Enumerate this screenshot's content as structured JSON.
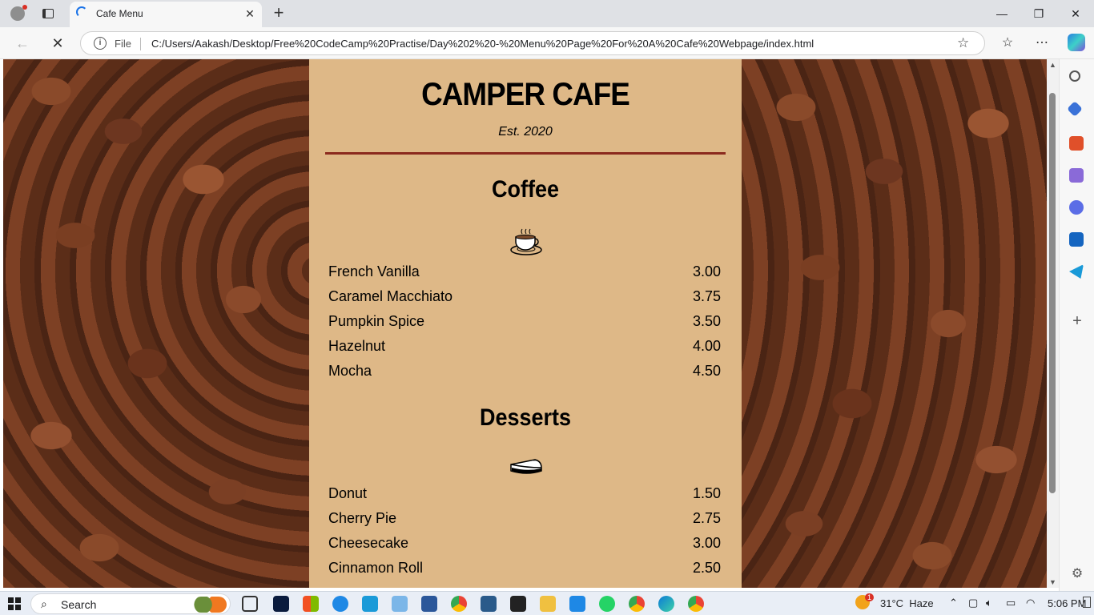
{
  "browser": {
    "tab_title": "Cafe Menu",
    "new_tab_symbol": "+",
    "close_tab_symbol": "✕",
    "address": {
      "scheme": "File",
      "url": "C:/Users/Aakash/Desktop/Free%20CodeCamp%20Practise/Day%202%20-%20Menu%20Page%20For%20A%20Cafe%20Webpage/index.html"
    }
  },
  "page": {
    "cafe_name": "CAMPER CAFE",
    "established": "Est. 2020",
    "sections": [
      {
        "title": "Coffee",
        "icon": "coffee-cup-icon",
        "items": [
          {
            "flavor": "French Vanilla",
            "price": "3.00"
          },
          {
            "flavor": "Caramel Macchiato",
            "price": "3.75"
          },
          {
            "flavor": "Pumpkin Spice",
            "price": "3.50"
          },
          {
            "flavor": "Hazelnut",
            "price": "4.00"
          },
          {
            "flavor": "Mocha",
            "price": "4.50"
          }
        ]
      },
      {
        "title": "Desserts",
        "icon": "pie-slice-icon",
        "items": [
          {
            "flavor": "Donut",
            "price": "1.50"
          },
          {
            "flavor": "Cherry Pie",
            "price": "2.75"
          },
          {
            "flavor": "Cheesecake",
            "price": "3.00"
          },
          {
            "flavor": "Cinnamon Roll",
            "price": "2.50"
          }
        ]
      }
    ],
    "colors": {
      "menu_background": "#deb887",
      "divider": "#8b2a1e"
    }
  },
  "taskbar": {
    "search_label": "Search",
    "weather": "31°C  Haze",
    "weather_badge": "1",
    "time": "5:06 PM"
  }
}
